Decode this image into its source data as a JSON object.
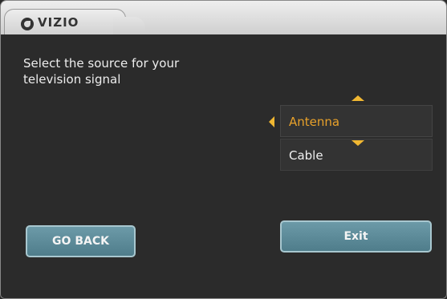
{
  "header": {
    "brand": "VIZIO",
    "logo_icon": "vizio-logo-icon"
  },
  "main": {
    "prompt_line1": "Select the source for your",
    "prompt_line2": "television signal",
    "options": [
      {
        "label": "Antenna",
        "selected": true
      },
      {
        "label": "Cable",
        "selected": false
      }
    ]
  },
  "buttons": {
    "back_label": "GO BACK",
    "exit_label": "Exit"
  },
  "colors": {
    "accent": "#f0b732",
    "selected_text": "#e8a12a",
    "button": "#5f8d9b"
  }
}
